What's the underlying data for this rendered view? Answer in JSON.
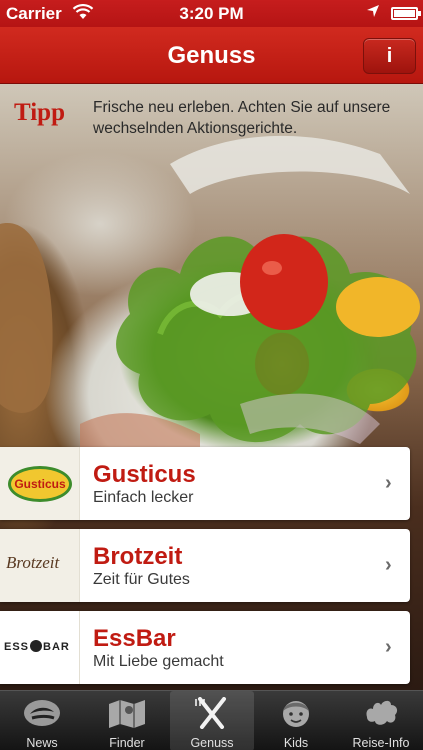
{
  "status_bar": {
    "carrier": "Carrier",
    "time": "3:20 PM"
  },
  "nav": {
    "title": "Genuss",
    "info_label": "i"
  },
  "tipp": {
    "label": "Tipp",
    "text": "Frische neu erleben. Achten Sie auf unsere wechselnden Aktionsgerichte."
  },
  "list": [
    {
      "name": "Gusticus",
      "subtitle": "Einfach lecker",
      "logo_text": "Gusticus"
    },
    {
      "name": "Brotzeit",
      "subtitle": "Zeit für Gutes",
      "logo_text": "Brotzeit"
    },
    {
      "name": "EssBar",
      "subtitle": "Mit Liebe gemacht",
      "logo_text_left": "ESS",
      "logo_text_right": "BAR"
    }
  ],
  "tabs": [
    {
      "label": "News",
      "icon": "news-icon"
    },
    {
      "label": "Finder",
      "icon": "map-icon"
    },
    {
      "label": "Genuss",
      "icon": "fork-knife-icon",
      "active": true
    },
    {
      "label": "Kids",
      "icon": "kid-face-icon"
    },
    {
      "label": "Reise-Info",
      "icon": "europe-map-icon"
    }
  ],
  "colors": {
    "brand_red": "#c01b12",
    "nav_red": "#c8241a",
    "tabbar": "#1e1e1e"
  }
}
